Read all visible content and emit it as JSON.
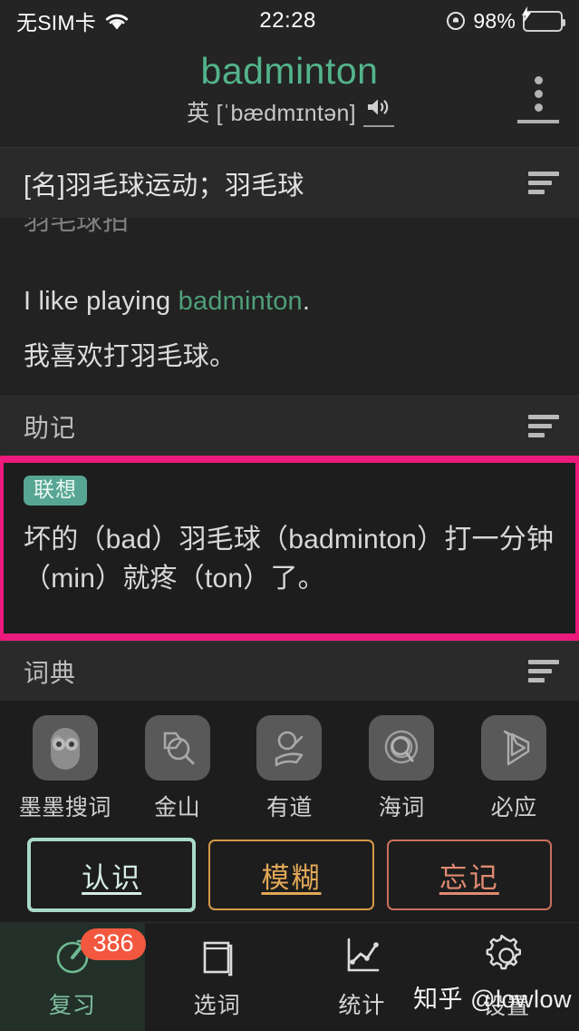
{
  "statusbar": {
    "carrier": "无SIM卡",
    "wifi_icon": "wifi-icon",
    "time": "22:28",
    "lock_icon": "rotation-lock-icon",
    "battery_percent": "98%",
    "battery_icon": "battery-charging-icon"
  },
  "header": {
    "word": "badminton",
    "phonetic": "英 [ˈbædmɪntən]",
    "speaker_icon": "speaker-icon",
    "menu_icon": "more-vertical-icon",
    "accent_color": "#53b48c"
  },
  "definition": {
    "text": "[名]羽毛球运动；羽毛球",
    "list_icon": "list-lines-icon"
  },
  "content": {
    "clipped_line": "羽毛球拍",
    "example_en_before": "I like playing ",
    "example_en_word": "badminton",
    "example_en_after": ".",
    "example_zh": "我喜欢打羽毛球。"
  },
  "mnemonic_section": {
    "title": "助记",
    "list_icon": "list-lines-icon",
    "badge": "联想",
    "text": "坏的（bad）羽毛球（badminton）打一分钟（min）就疼（ton）了。",
    "highlight_color": "#ec1a7c",
    "badge_color": "#57a693"
  },
  "dictionary_section": {
    "title": "词典",
    "list_icon": "list-lines-icon",
    "items": [
      {
        "label": "墨墨搜词",
        "icon": "owl-icon"
      },
      {
        "label": "金山",
        "icon": "kingsoft-icon"
      },
      {
        "label": "有道",
        "icon": "youdao-icon"
      },
      {
        "label": "海词",
        "icon": "haici-icon"
      },
      {
        "label": "必应",
        "icon": "bing-icon"
      }
    ]
  },
  "answers": [
    {
      "label": "认识",
      "color": "#a9d9c9",
      "name": "know-button"
    },
    {
      "label": "模糊",
      "color": "#d79a4a",
      "name": "fuzzy-button"
    },
    {
      "label": "忘记",
      "color": "#c9715b",
      "name": "forget-button"
    }
  ],
  "tabbar": [
    {
      "label": "复习",
      "icon": "timer-icon",
      "active": true,
      "badge": "386"
    },
    {
      "label": "选词",
      "icon": "book-icon",
      "active": false,
      "badge": ""
    },
    {
      "label": "统计",
      "icon": "chart-line-icon",
      "active": false,
      "badge": ""
    },
    {
      "label": "设置",
      "icon": "gear-icon",
      "active": false,
      "badge": ""
    }
  ],
  "watermark": "知乎 @lowlow"
}
